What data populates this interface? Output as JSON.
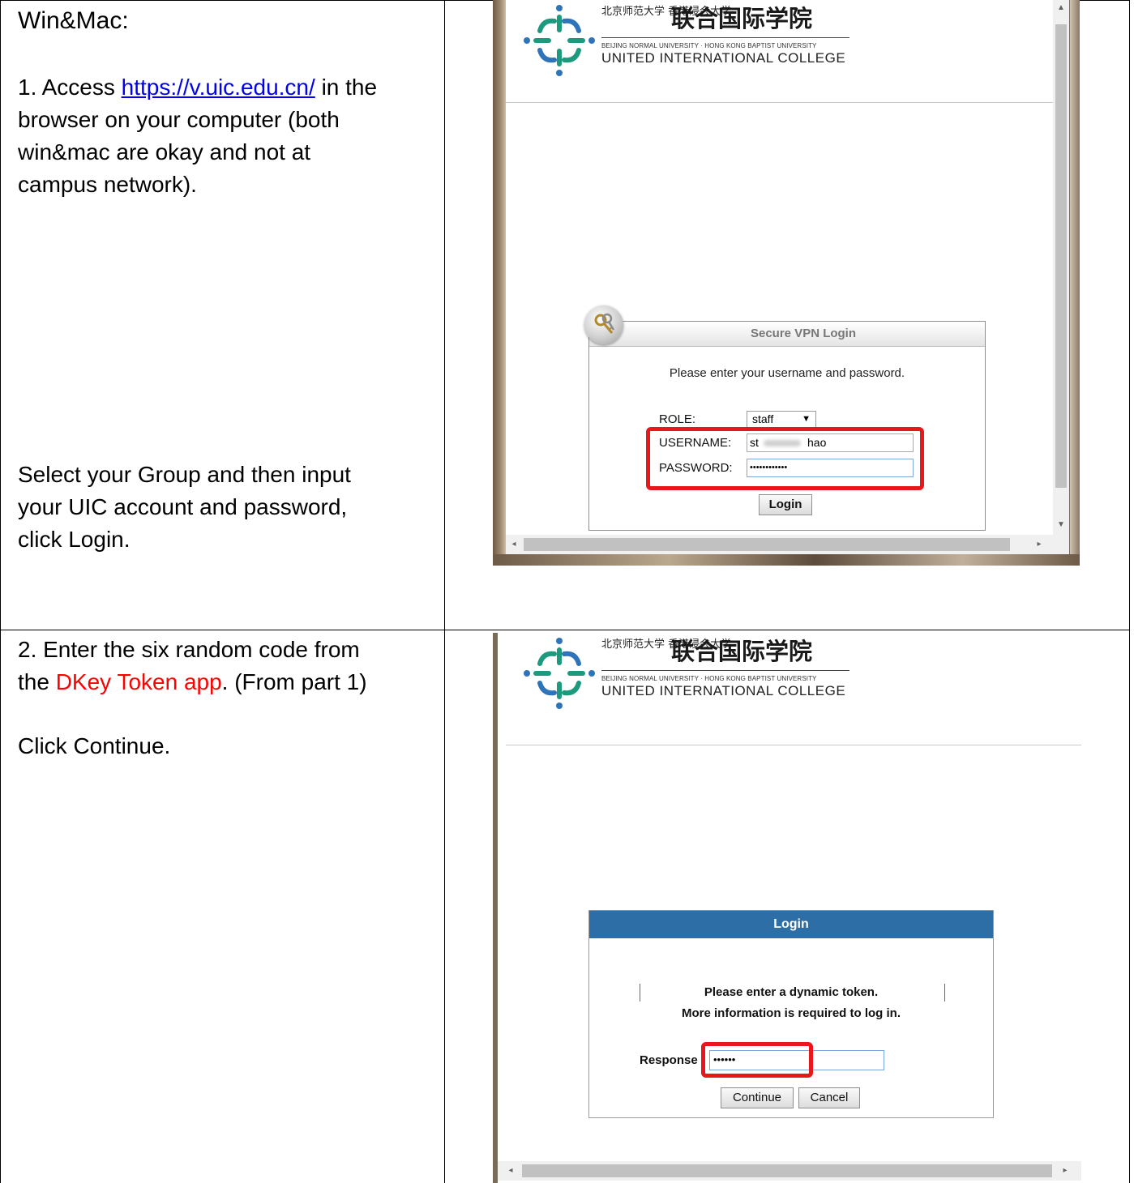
{
  "section1": {
    "heading": "Win&Mac:",
    "step1": {
      "prefix": "1.  Access ",
      "link": "https://v.uic.edu.cn/",
      "line1_suffix": " in the",
      "line2": "browser on your computer (both",
      "line3": "win&mac are okay and not at",
      "line4": "campus network)."
    },
    "step2": {
      "line1": "Select your Group and then input",
      "line2": "your UIC account and password,",
      "line3": "click Login."
    }
  },
  "section2": {
    "line1": "2.  Enter the six random code from",
    "line2_prefix": "the ",
    "line2_red": "DKey Token app",
    "line2_suffix": ". (From part 1)",
    "line3": "Click Continue."
  },
  "logo": {
    "cn_small": "北京师范大学 香港浸会大学",
    "cn_big": "联合国际学院",
    "en_small": "BEIJING NORMAL UNIVERSITY · HONG KONG BAPTIST UNIVERSITY",
    "en_big": "UNITED INTERNATIONAL COLLEGE"
  },
  "vpn_login": {
    "title": "Secure VPN Login",
    "prompt": "Please enter your username and password.",
    "role_label": "ROLE:",
    "role_value": "staff",
    "username_label": "USERNAME:",
    "username_start": "st",
    "username_end": "hao",
    "password_label": "PASSWORD:",
    "password_mask": "••••••••••••",
    "login_button": "Login"
  },
  "token_login": {
    "title": "Login",
    "line1": "Please enter a dynamic token.",
    "line2": "More information is required to log in.",
    "response_label": "Response",
    "response_mask": "••••••",
    "continue_button": "Continue",
    "cancel_button": "Cancel"
  },
  "colors": {
    "link": "#0000ee",
    "highlight": "#e8171b",
    "token_header": "#2e6ea6",
    "logo_green": "#1d9a7d",
    "logo_blue": "#2f73b9"
  }
}
